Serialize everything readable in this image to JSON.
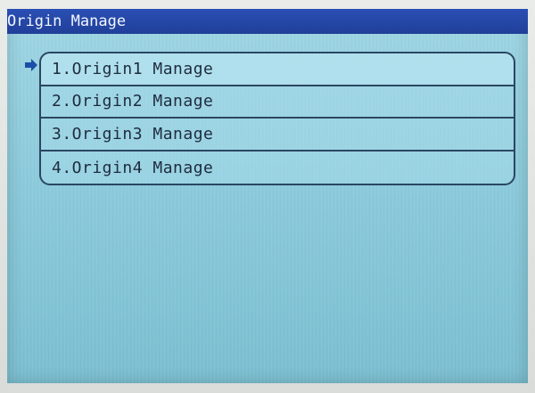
{
  "window": {
    "title": "Origin Manage"
  },
  "menu": {
    "selected_index": 0,
    "items": [
      {
        "label": "1.Origin1 Manage"
      },
      {
        "label": "2.Origin2 Manage"
      },
      {
        "label": "3.Origin3 Manage"
      },
      {
        "label": "4.Origin4 Manage"
      }
    ]
  },
  "icons": {
    "cursor": "arrow-right-icon"
  },
  "colors": {
    "title_bar": "#2a4fb5",
    "screen_background": "#8ccbdc",
    "menu_border": "#2b4662",
    "menu_text": "#1e2c3d",
    "title_text": "#f2f6ff",
    "cursor": "#1a4ea8"
  }
}
